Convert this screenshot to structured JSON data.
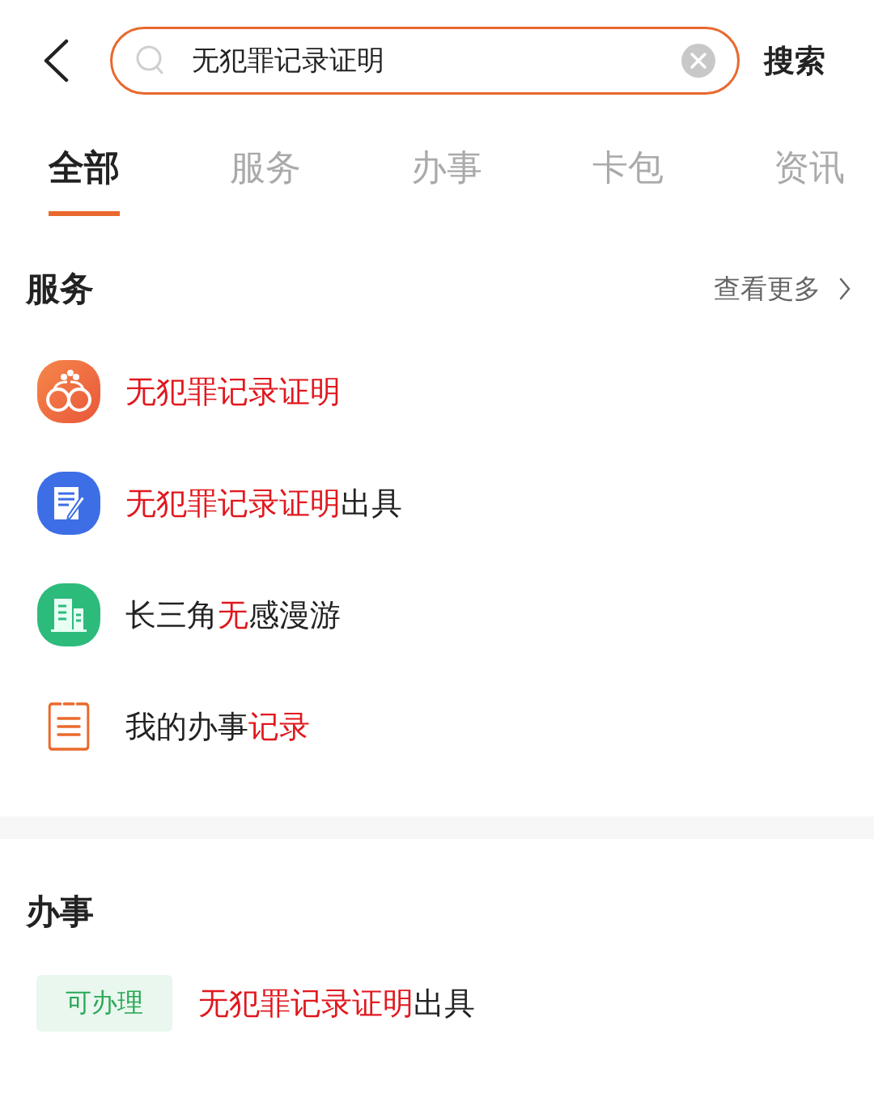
{
  "search": {
    "value": "无犯罪记录证明",
    "action": "搜索"
  },
  "tabs": [
    {
      "label": "全部",
      "selected": true
    },
    {
      "label": "服务",
      "selected": false
    },
    {
      "label": "办事",
      "selected": false
    },
    {
      "label": "卡包",
      "selected": false
    },
    {
      "label": "资讯",
      "selected": false
    }
  ],
  "services": {
    "title": "服务",
    "more": "查看更多",
    "items": [
      {
        "kind": "handcuffs",
        "title": [
          {
            "text": "无犯罪记录证明",
            "highlight": true
          }
        ]
      },
      {
        "kind": "document",
        "title": [
          {
            "text": "无犯罪记录证明",
            "highlight": true
          },
          {
            "text": "出具",
            "highlight": false
          }
        ]
      },
      {
        "kind": "building",
        "title": [
          {
            "text": "长三角",
            "highlight": false
          },
          {
            "text": "无",
            "highlight": true
          },
          {
            "text": "感漫游",
            "highlight": false
          }
        ]
      },
      {
        "kind": "clipboard",
        "title": [
          {
            "text": "我的办事",
            "highlight": false
          },
          {
            "text": "记录",
            "highlight": true
          }
        ]
      }
    ]
  },
  "affairs": {
    "title": "办事",
    "items": [
      {
        "badge": "可办理",
        "title": [
          {
            "text": "无犯罪记录证明",
            "highlight": true
          },
          {
            "text": "出具",
            "highlight": false
          }
        ]
      }
    ]
  }
}
